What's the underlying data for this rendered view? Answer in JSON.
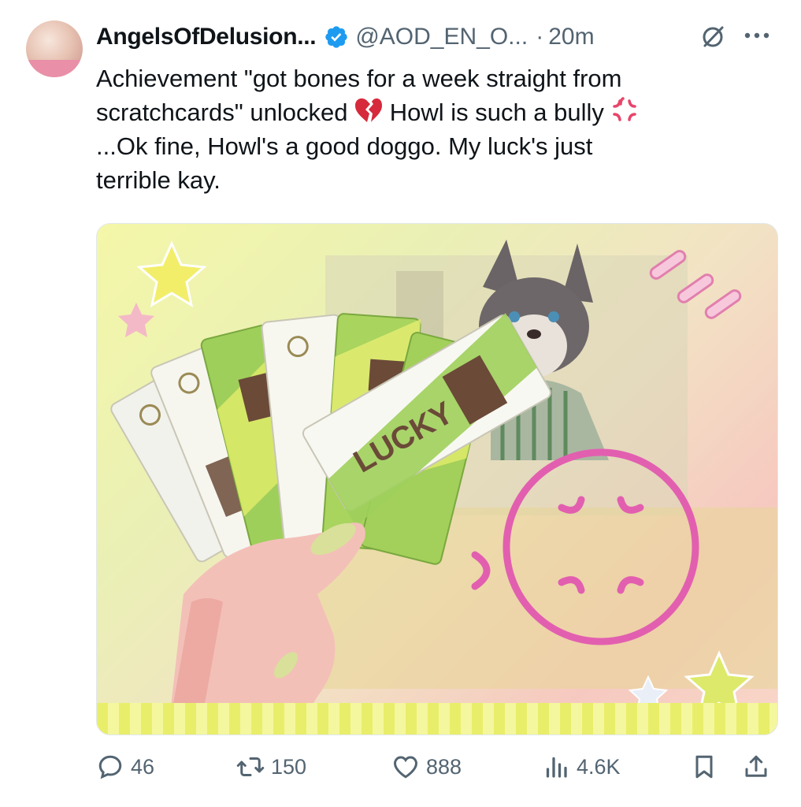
{
  "author": {
    "display_name": "AngelsOfDelusion...",
    "handle": "@AOD_EN_O...",
    "verified": true,
    "avatar_icon": "group-avatar"
  },
  "meta": {
    "separator": "·",
    "time": "20m"
  },
  "tweet": {
    "line1": "Achievement \"got bones for a week straight from",
    "line2a": "scratchcards\" unlocked",
    "line2b": "Howl is such a bully",
    "line3": "...Ok fine, Howl's a good doggo. My luck's just",
    "line4": "terrible kay.",
    "emojis": [
      "broken-heart-emoji",
      "anger-symbol-emoji"
    ]
  },
  "media": {
    "card_text": "LUCKY"
  },
  "actions": {
    "replies": "46",
    "retweets": "150",
    "likes": "888",
    "views": "4.6K"
  },
  "colors": {
    "accent_blue": "#1d9bf0",
    "muted": "#536471",
    "broken_heart": "#d6293b",
    "anger": "#e8456b"
  }
}
